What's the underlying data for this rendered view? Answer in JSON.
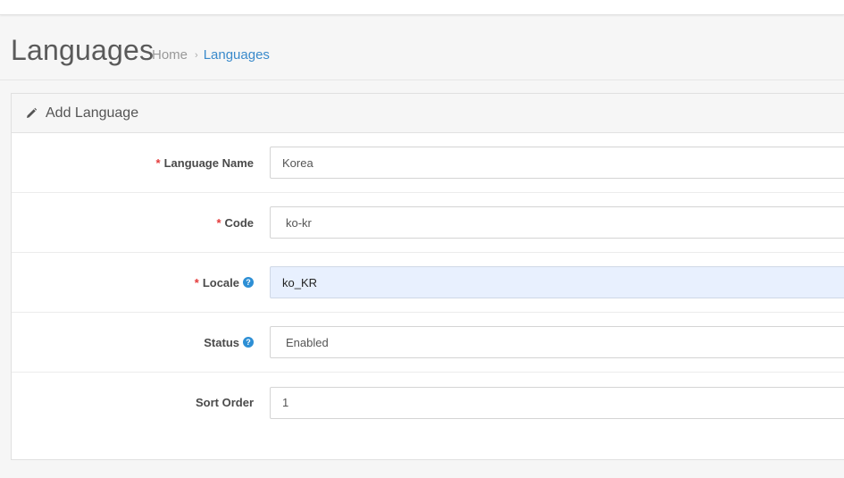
{
  "header": {
    "title": "Languages",
    "breadcrumb": {
      "home": "Home",
      "separator": "›",
      "current": "Languages"
    }
  },
  "panel": {
    "icon": "pencil-icon",
    "title": "Add Language"
  },
  "form": {
    "language_name": {
      "label": "Language Name",
      "required_mark": "*",
      "value": "Korea"
    },
    "code": {
      "label": "Code",
      "required_mark": "*",
      "value": "ko-kr"
    },
    "locale": {
      "label": "Locale",
      "required_mark": "*",
      "help": "?",
      "value": "ko_KR"
    },
    "status": {
      "label": "Status",
      "help": "?",
      "value": "Enabled"
    },
    "sort_order": {
      "label": "Sort Order",
      "value": "1"
    }
  },
  "colors": {
    "accent": "#3a8acb",
    "required": "#e43b3b",
    "help": "#2d8fd5",
    "autofill": "#e8f0fe"
  }
}
